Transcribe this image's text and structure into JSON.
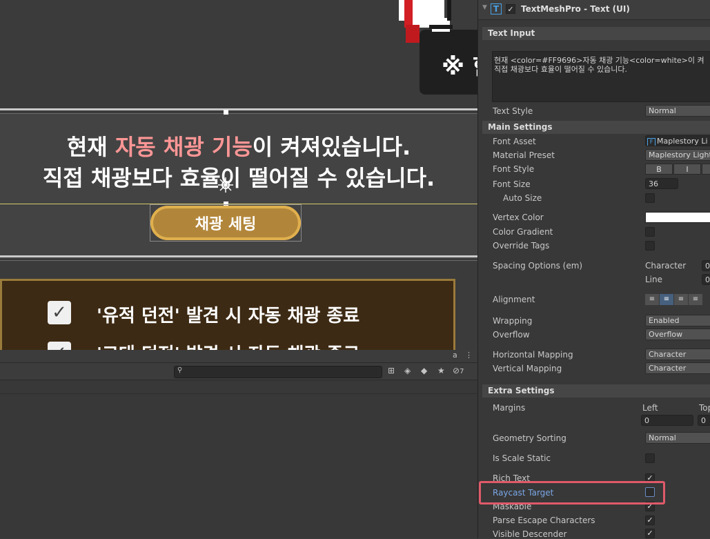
{
  "scene": {
    "toast_text": "※ 한",
    "main_message": {
      "line1_prefix": "현재 ",
      "line1_highlight": "자동 채광 기능",
      "line1_suffix": "이 켜져있습니다.",
      "line2": "직접 채광보다 효율이 떨어질 수 있습니다.",
      "highlight_color": "#FF9696"
    },
    "mine_setting_button": "채광 세팅",
    "checklist": [
      {
        "checked": true,
        "label": "'유적 던전' 발견 시 자동 채광 종료"
      },
      {
        "checked": true,
        "label": "'고대 던전' 발견 시 자동 채광 종료"
      }
    ]
  },
  "bottom_panel": {
    "lock_icon": "a",
    "menu_icon": "⋮",
    "search_placeholder": "",
    "hidden_count": "7"
  },
  "inspector": {
    "component_title": "TextMeshPro - Text (UI)",
    "component_icon": "T",
    "text_input_header": "Text Input",
    "text_input_value": "현재 <color=#FF9696>자동 채광 기능<color=white>이 켜\n직접 채광보다 효율이 떨어질 수 있습니다.",
    "text_style_label": "Text Style",
    "text_style_value": "Normal",
    "main_settings_header": "Main Settings",
    "font_asset_label": "Font Asset",
    "font_asset_value": "Maplestory Li",
    "material_preset_label": "Material Preset",
    "material_preset_value": "Maplestory Light",
    "font_style_label": "Font Style",
    "font_style_buttons": [
      "B",
      "I"
    ],
    "font_size_label": "Font Size",
    "font_size_value": "36",
    "auto_size_label": "Auto Size",
    "vertex_color_label": "Vertex Color",
    "color_gradient_label": "Color Gradient",
    "override_tags_label": "Override Tags",
    "spacing_label": "Spacing Options (em)",
    "spacing_character_label": "Character",
    "spacing_character_value": "0",
    "spacing_line_label": "Line",
    "spacing_line_value": "0",
    "alignment_label": "Alignment",
    "wrapping_label": "Wrapping",
    "wrapping_value": "Enabled",
    "overflow_label": "Overflow",
    "overflow_value": "Overflow",
    "h_mapping_label": "Horizontal Mapping",
    "h_mapping_value": "Character",
    "v_mapping_label": "Vertical Mapping",
    "v_mapping_value": "Character",
    "extra_settings_header": "Extra Settings",
    "margins_label": "Margins",
    "margins_left_label": "Left",
    "margins_left_value": "0",
    "margins_top_label": "Top",
    "margins_top_value": "0",
    "geometry_sorting_label": "Geometry Sorting",
    "geometry_sorting_value": "Normal",
    "is_scale_static_label": "Is Scale Static",
    "rich_text_label": "Rich Text",
    "raycast_target_label": "Raycast Target",
    "maskable_label": "Maskable",
    "parse_escape_label": "Parse Escape Characters",
    "visible_descender_label": "Visible Descender",
    "highlight_color": "#e05a6a"
  }
}
